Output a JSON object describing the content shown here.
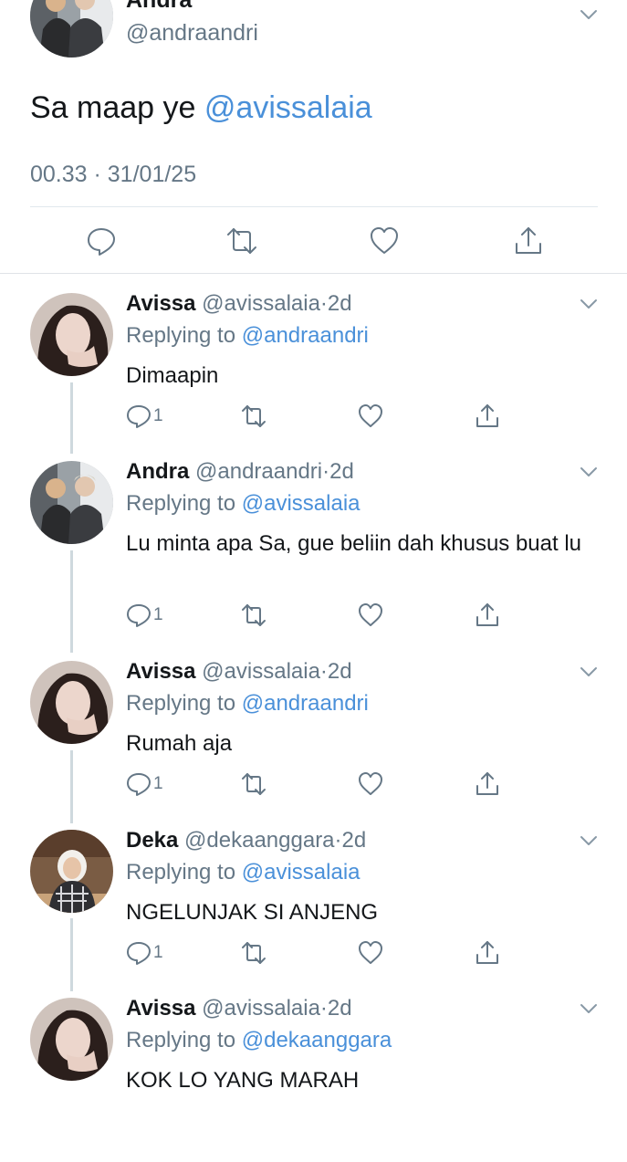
{
  "main_tweet": {
    "name": "Andra",
    "handle": "@andraandri",
    "text_plain": "Sa maap ye ",
    "text_mention": "@avissalaia",
    "time": "00.33",
    "separator": " · ",
    "date": "31/01/25",
    "actions": [
      "reply-icon",
      "retweet-icon",
      "like-icon",
      "share-icon"
    ]
  },
  "replies": [
    {
      "name": "Avissa",
      "handle": "@avissalaia",
      "age": "2d",
      "replying_prefix": "Replying to ",
      "replying_to": "@andraandri",
      "text": "Dimaapin",
      "reply_count": "1",
      "avatar": "avissa"
    },
    {
      "name": "Andra",
      "handle": "@andraandri",
      "age": "2d",
      "replying_prefix": "Replying to ",
      "replying_to": "@avissalaia",
      "text": "Lu minta apa Sa, gue beliin dah khusus buat lu",
      "reply_count": "1",
      "avatar": "andra"
    },
    {
      "name": "Avissa",
      "handle": "@avissalaia",
      "age": "2d",
      "replying_prefix": "Replying to ",
      "replying_to": "@andraandri",
      "text": "Rumah aja",
      "reply_count": "1",
      "avatar": "avissa"
    },
    {
      "name": "Deka",
      "handle": "@dekaanggara",
      "age": "2d",
      "replying_prefix": "Replying to ",
      "replying_to": "@avissalaia",
      "text": "NGELUNJAK SI ANJENG",
      "reply_count": "1",
      "avatar": "deka"
    },
    {
      "name": "Avissa",
      "handle": "@avissalaia",
      "age": "2d",
      "replying_prefix": "Replying to ",
      "replying_to": "@dekaanggara",
      "text": "KOK LO YANG MARAH",
      "reply_count": "",
      "avatar": "avissa"
    }
  ],
  "colors": {
    "mention": "#4a90d9",
    "secondary_text": "#657786",
    "divider": "#e1e8ed",
    "thread_line": "#cfd9de"
  }
}
